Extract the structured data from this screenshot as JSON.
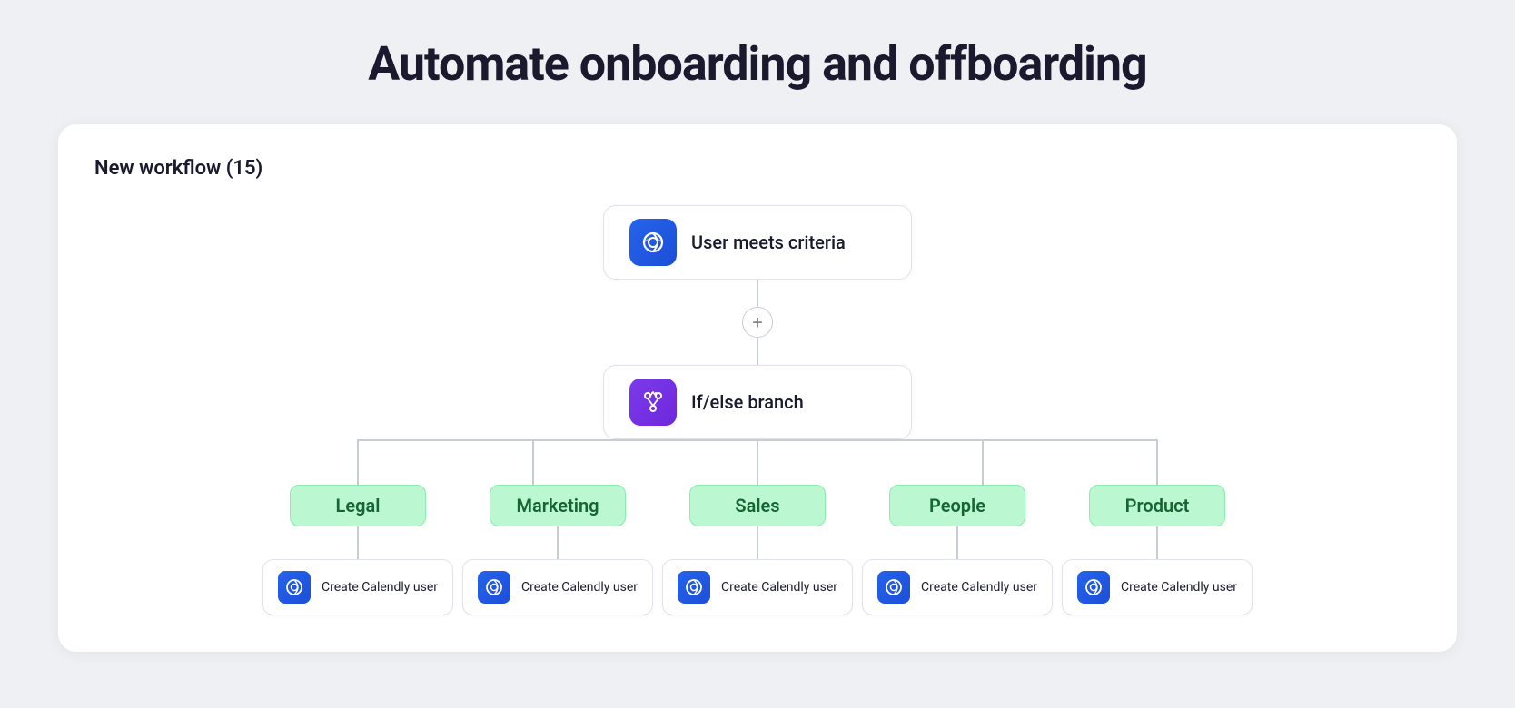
{
  "page": {
    "title": "Automate onboarding and offboarding"
  },
  "workflow": {
    "title": "New workflow (15)",
    "trigger_node": {
      "label": "User meets criteria"
    },
    "branch_node": {
      "label": "If/else branch"
    },
    "add_button_label": "+",
    "branches": [
      {
        "label": "Legal",
        "action": "Create Calendly user"
      },
      {
        "label": "Marketing",
        "action": "Create Calendly user"
      },
      {
        "label": "Sales",
        "action": "Create Calendly user"
      },
      {
        "label": "People",
        "action": "Create Calendly user"
      },
      {
        "label": "Product",
        "action": "Create Calendly user"
      }
    ]
  }
}
